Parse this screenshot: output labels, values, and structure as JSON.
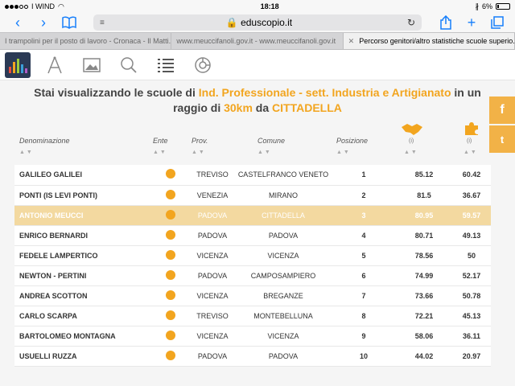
{
  "status": {
    "carrier": "I WIND",
    "time": "18:18",
    "battery": "6%"
  },
  "browser": {
    "url": "eduscopio.it",
    "tabs": [
      {
        "label": "I trampolini per il posto di lavoro - Cronaca - Il Matti..."
      },
      {
        "label": "www.meuccifanoli.gov.it - www.meuccifanoli.gov.it"
      },
      {
        "label": "Percorso genitori/altro statistiche scuole superio..."
      }
    ]
  },
  "heading": {
    "part1": "Stai visualizzando le scuole di ",
    "type": "Ind. Professionale - sett. Industria e Artigianato",
    "part2": " in un raggio di ",
    "radius": "30km",
    "part3": " da ",
    "city": "CITTADELLA"
  },
  "columns": {
    "name": "Denominazione",
    "ente": "Ente",
    "prov": "Prov.",
    "comune": "Comune",
    "posizione": "Posizione",
    "info1": "(i)",
    "info2": "(i)"
  },
  "social": {
    "facebook": "f",
    "twitter": "t"
  },
  "rows": [
    {
      "name": "GALILEO GALILEI",
      "prov": "TREVISO",
      "comune": "CASTELFRANCO VENETO",
      "pos": "1",
      "v1": "85.12",
      "v2": "60.42"
    },
    {
      "name": "PONTI (IS LEVI PONTI)",
      "prov": "VENEZIA",
      "comune": "MIRANO",
      "pos": "2",
      "v1": "81.5",
      "v2": "36.67"
    },
    {
      "name": "ANTONIO MEUCCI",
      "prov": "PADOVA",
      "comune": "CITTADELLA",
      "pos": "3",
      "v1": "80.95",
      "v2": "59.57"
    },
    {
      "name": "ENRICO BERNARDI",
      "prov": "PADOVA",
      "comune": "PADOVA",
      "pos": "4",
      "v1": "80.71",
      "v2": "49.13"
    },
    {
      "name": "FEDELE LAMPERTICO",
      "prov": "VICENZA",
      "comune": "VICENZA",
      "pos": "5",
      "v1": "78.56",
      "v2": "50"
    },
    {
      "name": "NEWTON - PERTINI",
      "prov": "PADOVA",
      "comune": "CAMPOSAMPIERO",
      "pos": "6",
      "v1": "74.99",
      "v2": "52.17"
    },
    {
      "name": "ANDREA SCOTTON",
      "prov": "VICENZA",
      "comune": "BREGANZE",
      "pos": "7",
      "v1": "73.66",
      "v2": "50.78"
    },
    {
      "name": "CARLO SCARPA",
      "prov": "TREVISO",
      "comune": "MONTEBELLUNA",
      "pos": "8",
      "v1": "72.21",
      "v2": "45.13"
    },
    {
      "name": "BARTOLOMEO MONTAGNA",
      "prov": "VICENZA",
      "comune": "VICENZA",
      "pos": "9",
      "v1": "58.06",
      "v2": "36.11"
    },
    {
      "name": "USUELLI RUZZA",
      "prov": "PADOVA",
      "comune": "PADOVA",
      "pos": "10",
      "v1": "44.02",
      "v2": "20.97"
    }
  ],
  "highlightRow": 2
}
